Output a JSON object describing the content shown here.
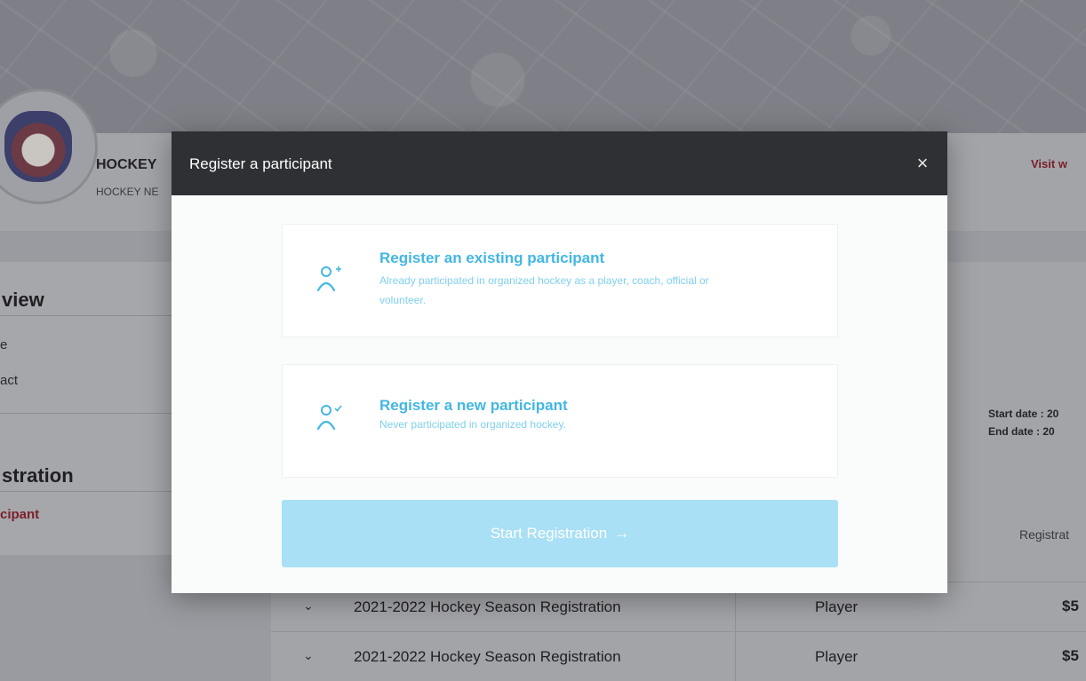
{
  "background": {
    "org_name": "HOCKEY",
    "org_sub": "HOCKEY NE",
    "visit_link": "Visit w",
    "sidebar": {
      "overview_title": "view",
      "overview_items": [
        "e",
        "act"
      ],
      "registration_title": "stration",
      "registration_active": "cipant"
    },
    "dates": {
      "start": "Start date : 20",
      "end": "End date : 20"
    },
    "table": {
      "column_header": "Registrat",
      "rows": [
        {
          "name": "2021-2022 Hockey Season Registration",
          "role": "Player",
          "price": "$5"
        },
        {
          "name": "2021-2022 Hockey Season Registration",
          "role": "Player",
          "price": "$5"
        }
      ]
    }
  },
  "modal": {
    "title": "Register a participant",
    "close_icon": "×",
    "options": [
      {
        "icon": "user-plus-icon",
        "title": "Register an existing participant",
        "description": "Already participated in organized hockey as a player, coach, official or volunteer."
      },
      {
        "icon": "user-check-icon",
        "title": "Register a new participant",
        "description": "Never participated in organized hockey."
      }
    ],
    "start_button": "Start Registration",
    "start_arrow": "→"
  },
  "colors": {
    "accent": "#43b7e3",
    "accent_light": "#7fd0ee",
    "button_bg": "#a9e0f5",
    "header_bg": "#2f3034",
    "link_red": "#7a1f2a"
  }
}
